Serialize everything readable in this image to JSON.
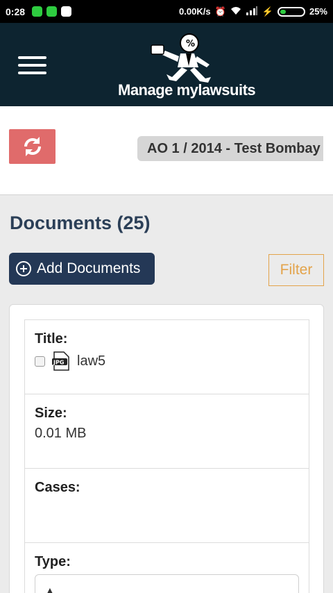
{
  "status_bar": {
    "time": "0:28",
    "network_speed": "0.00K/s",
    "battery": "25%",
    "battery_level": 0.25,
    "icon_colors": [
      "#2ecc40",
      "#2ecc40",
      "#ffffff"
    ]
  },
  "header": {
    "logo_text": "Manage mylawsuits",
    "menu_icon": "hamburger-icon"
  },
  "case_bar": {
    "refresh_icon": "refresh-icon",
    "selected_case": "AO 1 / 2014 - Test Bombay"
  },
  "documents": {
    "heading": "Documents (25)",
    "add_button_label": "Add Documents",
    "filter_label": "Filter"
  },
  "document_card": {
    "title_label": "Title:",
    "title_value": "law5",
    "file_type": "JPG",
    "size_label": "Size:",
    "size_value": "0.01 MB",
    "cases_label": "Cases:",
    "cases_value": "",
    "type_label": "Type:"
  },
  "colors": {
    "header_bg": "#0d2430",
    "refresh_bg": "#e06b6b",
    "primary_button": "#243856",
    "filter_accent": "#e3a34a",
    "heading_text": "#2b3f57"
  }
}
